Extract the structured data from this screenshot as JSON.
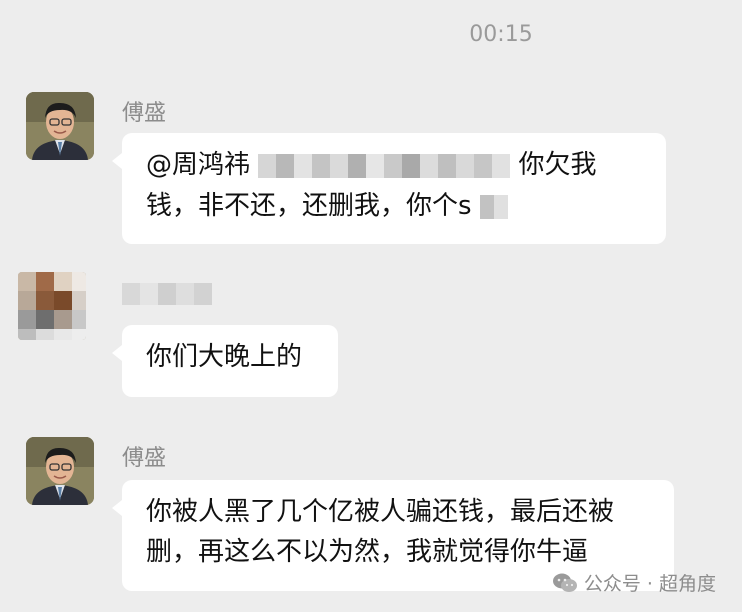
{
  "timestamp": "00:15",
  "messages": [
    {
      "sender": "傅盛",
      "lines": [
        "@周鸿祎",
        "你欠我",
        "钱，非不还，还删我，你个s"
      ]
    },
    {
      "sender": "",
      "lines": [
        "你们大晚上的"
      ]
    },
    {
      "sender": "傅盛",
      "lines": [
        "你被人黑了几个亿被人骗还钱，最后还被",
        "删，再这么不以为然，我就觉得你牛逼"
      ]
    }
  ],
  "watermark": {
    "text": "公众号 · 超角度",
    "icon": "wechat-official-account-icon"
  },
  "colors": {
    "background": "#ededed",
    "bubble": "#ffffff",
    "timestamp": "#9a9a9a"
  }
}
